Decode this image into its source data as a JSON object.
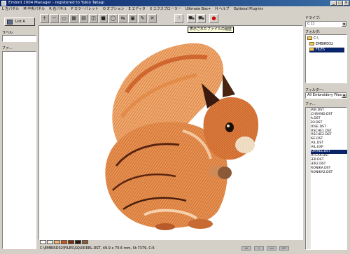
{
  "window": {
    "title": "Embird 2004 Manager - registered to Yukio Takagi"
  },
  "menu": [
    "L 左パネル",
    "M 中央パネル",
    "R 右パネル",
    "P カラーパレット",
    "O オプション",
    "E エディタ",
    "X エクスプローラー",
    "Ultimate Box+",
    "H ヘルプ",
    "Optional Plug-ins"
  ],
  "toolbar": {
    "icons": [
      "zoom-in-icon",
      "zoom-out-icon",
      "fit-icon",
      "grid-icon",
      "rulers-icon",
      "3d-icon",
      "color-icon",
      "hoop-icon",
      "trace-icon",
      "print-icon",
      "edit-icon",
      "delete-icon",
      "history-icon",
      "cart-icon",
      "cart-add-icon",
      "needle-icon"
    ],
    "glyphs": [
      "＋",
      "－",
      "▭",
      "▦",
      "▤",
      "◫",
      "■",
      "◯",
      "⇆",
      "▣",
      "✎",
      "✕",
      "☝",
      "⛟",
      "⛟",
      "●"
    ]
  },
  "tooltip": "表示されたファイルの履歴",
  "left_panel": {
    "list_button": "List A",
    "label_caption": "ラベル:",
    "file_caption": "ファ..."
  },
  "right_panel": {
    "drive_caption": "ドライブ:",
    "drive_value": "c: []",
    "folder_caption": "フォルダ:",
    "folders": [
      "C:\\",
      "EMBIRD32",
      "FILES"
    ],
    "filter_caption": "フィルター:",
    "filter_value": "All Embroidery Files",
    "files_caption": "ファ...",
    "files": [
      "CHAIR.DST",
      "DACHSHND.DST",
      "EVA.DST",
      "MISO.DST",
      "MOOSE.DST",
      "PORSCHE1.DST",
      "PORSCHE2.DST",
      "ROSE.DST",
      "SNAIL.DST",
      "SNAIL.EXP",
      "SQUIRREL.DST",
      "SURFCAR.DST",
      "TIGER.DST",
      "TIGER2.DST",
      "VERONIKA.DST",
      "VERONIKA2.DST"
    ],
    "selected_file": "SQUIRREL.DST"
  },
  "palette": [
    "#ffffff",
    "#f5f0e6",
    "#f2b27a",
    "#c45a1c",
    "#7a2e10",
    "#2b1a12",
    "#8a5a38"
  ],
  "status": {
    "text": "C:\\EMBIRD32\\FILES\\SQUIRREL.DST, 49.9 x 70.6 mm, St:7379, C:6",
    "right_items": [
      "AA",
      "0",
      "mm",
      "DST"
    ]
  }
}
